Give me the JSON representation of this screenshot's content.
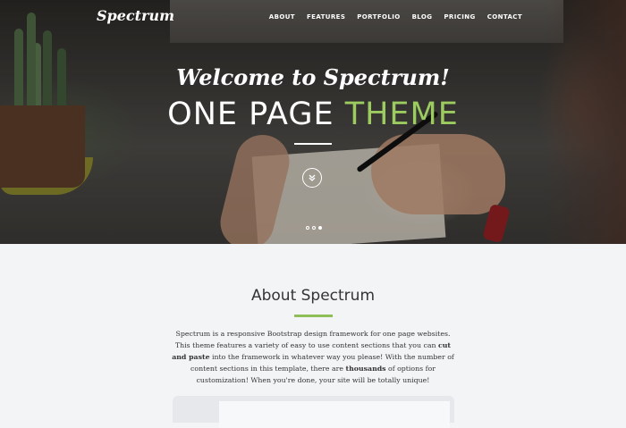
{
  "brand": {
    "name": "Spectrum"
  },
  "nav": {
    "items": [
      {
        "label": "ABOUT"
      },
      {
        "label": "FEATURES"
      },
      {
        "label": "PORTFOLIO"
      },
      {
        "label": "BLOG"
      },
      {
        "label": "PRICING"
      },
      {
        "label": "CONTACT"
      }
    ]
  },
  "hero": {
    "welcome": "Welcome to Spectrum!",
    "headline_main": "ONE PAGE ",
    "headline_accent": "THEME",
    "scroll_icon": "chevron-double-down-icon",
    "slides": {
      "count": 3,
      "active": 3
    }
  },
  "about": {
    "title": "About Spectrum",
    "text_1": "Spectrum is a responsive Bootstrap design framework for one page websites. This theme features a variety of easy to use content sections that you can ",
    "bold_1": "cut and paste",
    "text_2": " into the framework in whatever way you please! With the number of content sections in this template, there are ",
    "bold_2": "thousands",
    "text_3": " of options for customization! When you're done, your site will be totally unique!"
  },
  "colors": {
    "accent": "#9ccc5f",
    "accent_rule": "#8fbd57"
  }
}
